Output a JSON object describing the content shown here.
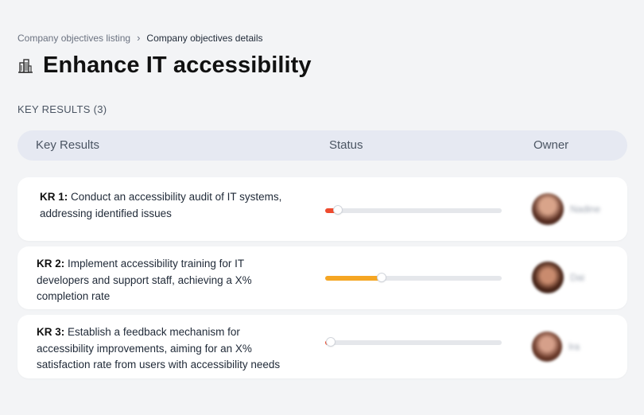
{
  "breadcrumb": {
    "items": [
      "Company objectives listing",
      "Company objectives details"
    ]
  },
  "page": {
    "title": "Enhance IT accessibility",
    "icon": "building-icon"
  },
  "section": {
    "label": "KEY RESULTS (3)"
  },
  "table": {
    "columns": [
      "Key Results",
      "Status",
      "Owner"
    ],
    "rows": [
      {
        "kr_label": "KR 1:",
        "lines": [
          "Conduct an accessibility audit of IT systems,",
          "addressing identified issues"
        ],
        "progress": 0.07,
        "progress_color": "#ef4b2e",
        "owner": "Nadine"
      },
      {
        "kr_label": "KR 2:",
        "lines": [
          "Implement accessibility training for IT",
          "developers and support staff, achieving a X%",
          "completion rate"
        ],
        "progress": 0.32,
        "progress_color": "#f5a623",
        "owner": "Dai"
      },
      {
        "kr_label": "KR 3:",
        "lines": [
          "Establish a feedback mechanism for",
          "accessibility improvements, aiming for an X%",
          "satisfaction rate from users with accessibility needs"
        ],
        "progress": 0.03,
        "progress_color": "#ef4b2e",
        "owner": "Ira"
      }
    ]
  }
}
